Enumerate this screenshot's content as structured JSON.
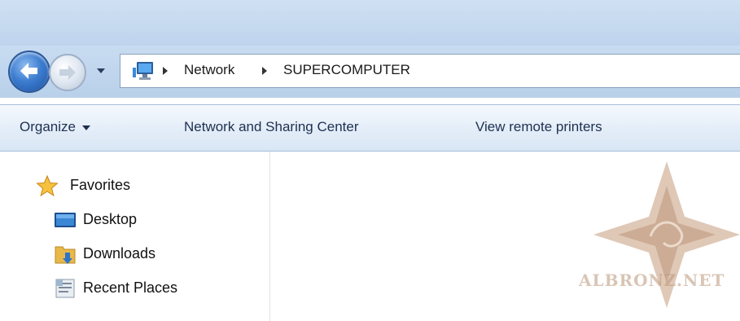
{
  "address_bar": {
    "crumbs": [
      "Network",
      "SUPERCOMPUTER"
    ]
  },
  "command_bar": {
    "organize_label": "Organize",
    "network_sharing_label": "Network and Sharing Center",
    "view_printers_label": "View remote printers"
  },
  "nav_pane": {
    "favorites_label": "Favorites",
    "items": [
      {
        "label": "Desktop",
        "icon": "desktop-icon"
      },
      {
        "label": "Downloads",
        "icon": "downloads-folder-icon"
      },
      {
        "label": "Recent Places",
        "icon": "recent-places-icon"
      }
    ]
  },
  "watermark": {
    "text": "ALBRONZ.NET"
  }
}
